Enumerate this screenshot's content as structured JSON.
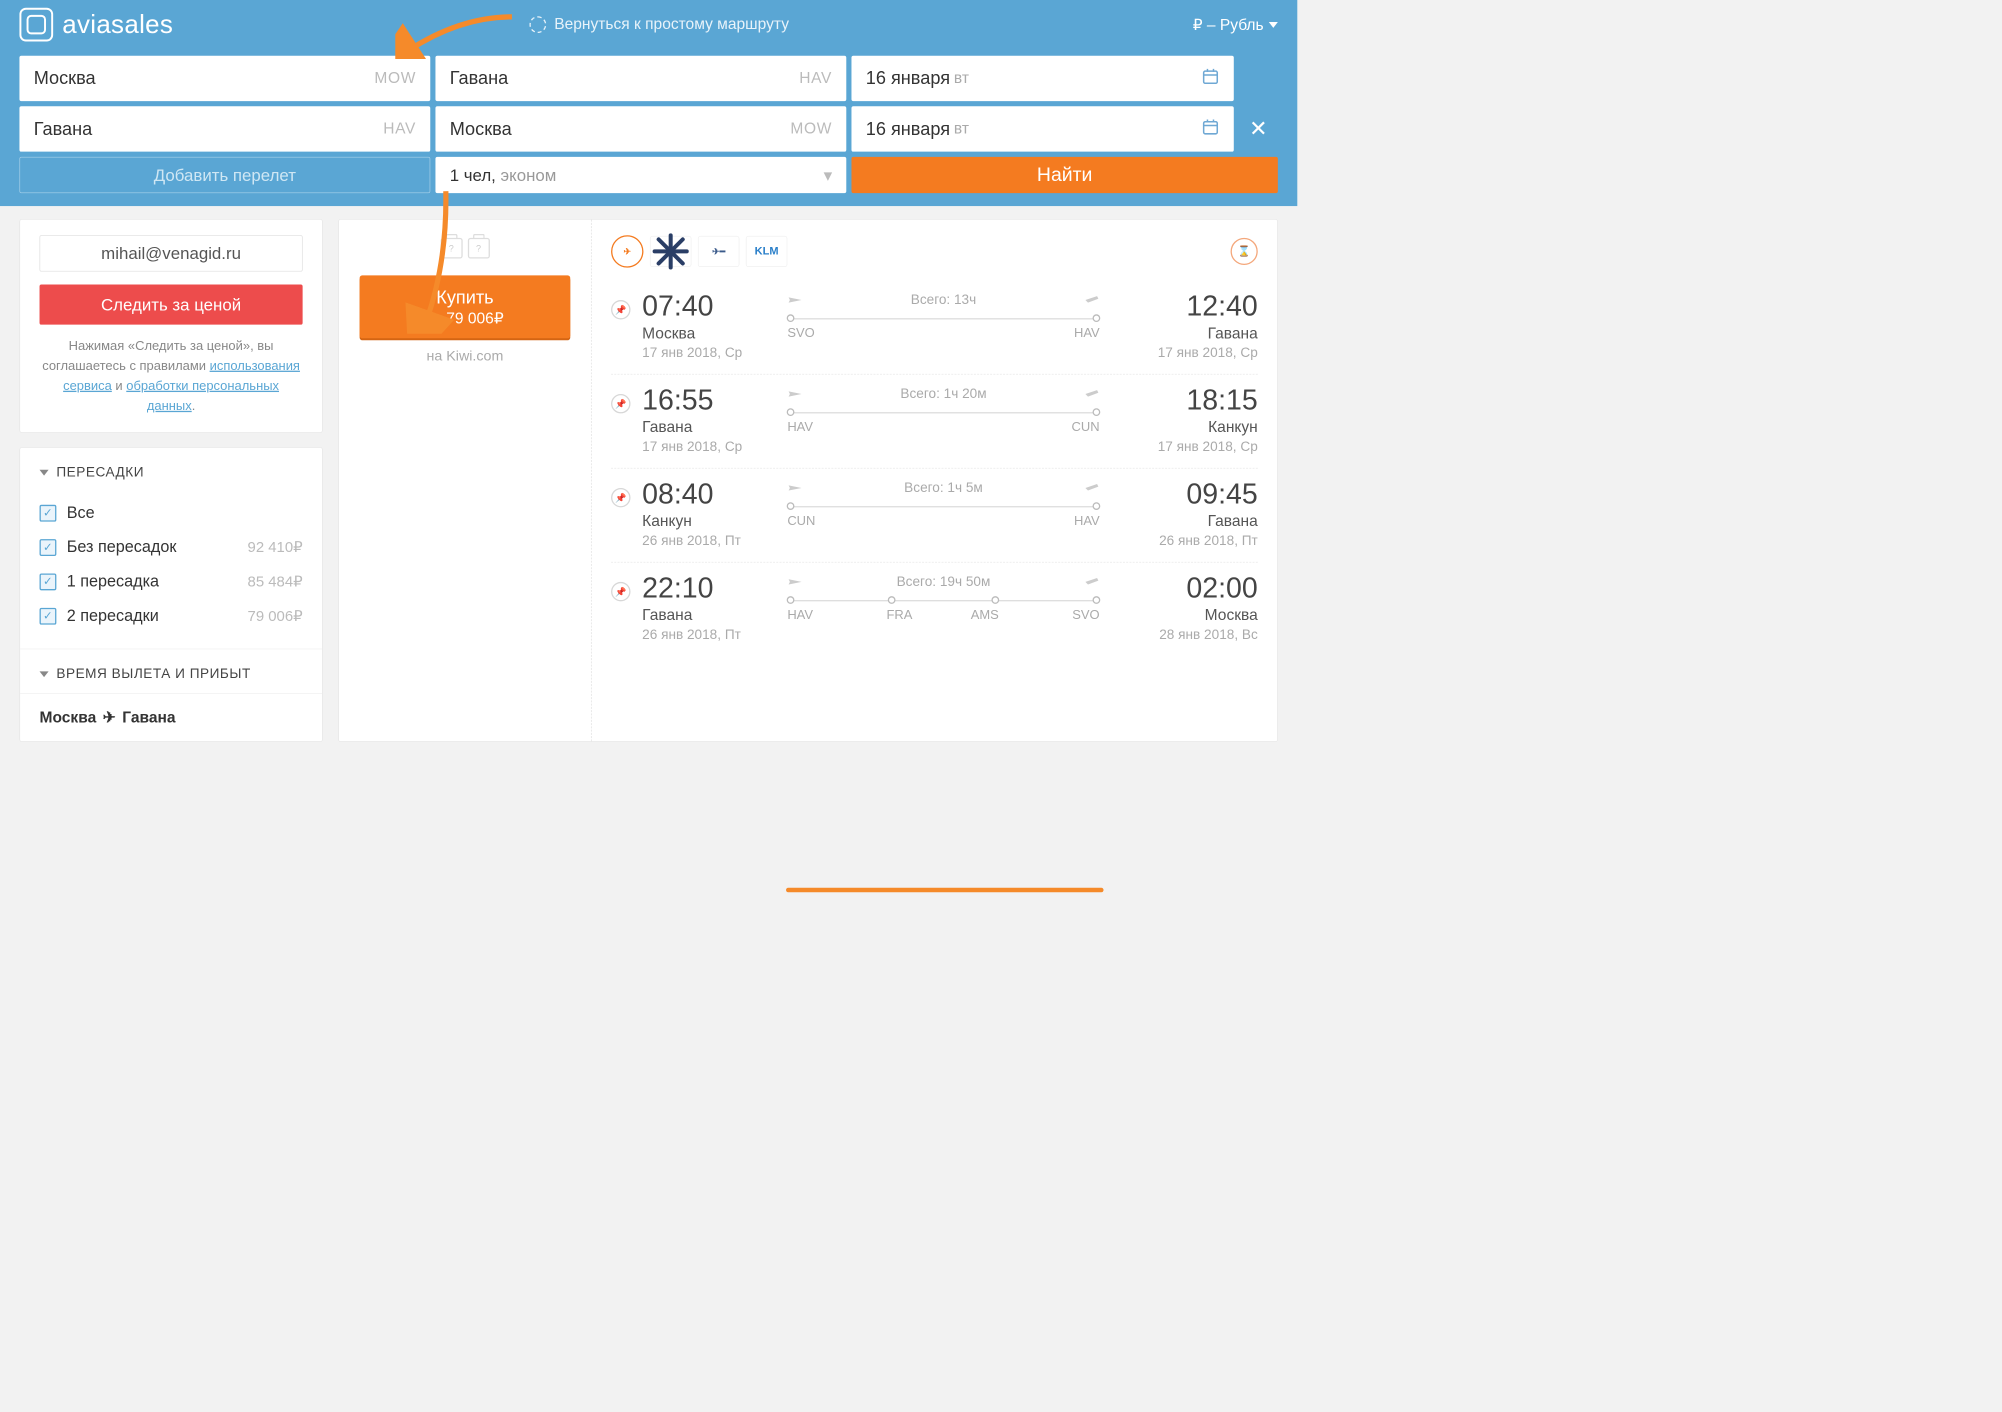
{
  "header": {
    "brand": "aviasales",
    "back_to_simple": "Вернуться к простому маршруту",
    "currency": "₽ – Рубль"
  },
  "search": {
    "rows": [
      {
        "from_city": "Москва",
        "from_code": "MOW",
        "to_city": "Гавана",
        "to_code": "HAV",
        "date": "16 января",
        "weekday": "вт"
      },
      {
        "from_city": "Гавана",
        "from_code": "HAV",
        "to_city": "Москва",
        "to_code": "MOW",
        "date": "16 января",
        "weekday": "вт"
      }
    ],
    "add_flight": "Добавить перелет",
    "passengers_count": "1 чел,",
    "passengers_class": "эконом",
    "search_btn": "Найти"
  },
  "sidebar": {
    "email": "mihail@venagid.ru",
    "watch_price": "Следить за ценой",
    "terms_prefix": "Нажимая «Следить за ценой», вы соглашаетесь с правилами ",
    "terms_link1": "использования сервиса",
    "terms_and": " и ",
    "terms_link2": "обработки персональных данных",
    "terms_dot": ".",
    "filter_stops_title": "ПЕРЕСАДКИ",
    "stops": [
      {
        "label": "Все",
        "price": ""
      },
      {
        "label": "Без пересадок",
        "price": "92 410₽"
      },
      {
        "label": "1 пересадка",
        "price": "85 484₽"
      },
      {
        "label": "2 пересадки",
        "price": "79 006₽"
      }
    ],
    "filter_time_title": "ВРЕМЯ ВЫЛЕТА И ПРИБЫТ",
    "route_from": "Москва",
    "route_to": "Гавана"
  },
  "ticket": {
    "bag1": "?",
    "bag2": "?",
    "buy_title": "Купить",
    "buy_price": "за 79 006₽",
    "via": "на Kiwi.com",
    "airlines": [
      "condor",
      "interjet",
      "aeroflot",
      "KLM"
    ],
    "segments": [
      {
        "dep_time": "07:40",
        "dep_city": "Москва",
        "dep_date": "17 янв 2018, Ср",
        "dur_label": "Всего: 13ч",
        "route": [
          "SVO",
          "HAV"
        ],
        "mid": [],
        "arr_time": "12:40",
        "arr_city": "Гавана",
        "arr_date": "17 янв 2018, Ср"
      },
      {
        "dep_time": "16:55",
        "dep_city": "Гавана",
        "dep_date": "17 янв 2018, Ср",
        "dur_label": "Всего: 1ч 20м",
        "route": [
          "HAV",
          "CUN"
        ],
        "mid": [],
        "arr_time": "18:15",
        "arr_city": "Канкун",
        "arr_date": "17 янв 2018, Ср"
      },
      {
        "dep_time": "08:40",
        "dep_city": "Канкун",
        "dep_date": "26 янв 2018, Пт",
        "dur_label": "Всего: 1ч 5м",
        "route": [
          "CUN",
          "HAV"
        ],
        "mid": [],
        "arr_time": "09:45",
        "arr_city": "Гавана",
        "arr_date": "26 янв 2018, Пт"
      },
      {
        "dep_time": "22:10",
        "dep_city": "Гавана",
        "dep_date": "26 янв 2018, Пт",
        "dur_label": "Всего: 19ч 50м",
        "route": [
          "HAV",
          "SVO"
        ],
        "mid": [
          "FRA",
          "AMS"
        ],
        "arr_time": "02:00",
        "arr_city": "Москва",
        "arr_date": "28 янв 2018, Вс"
      }
    ]
  }
}
